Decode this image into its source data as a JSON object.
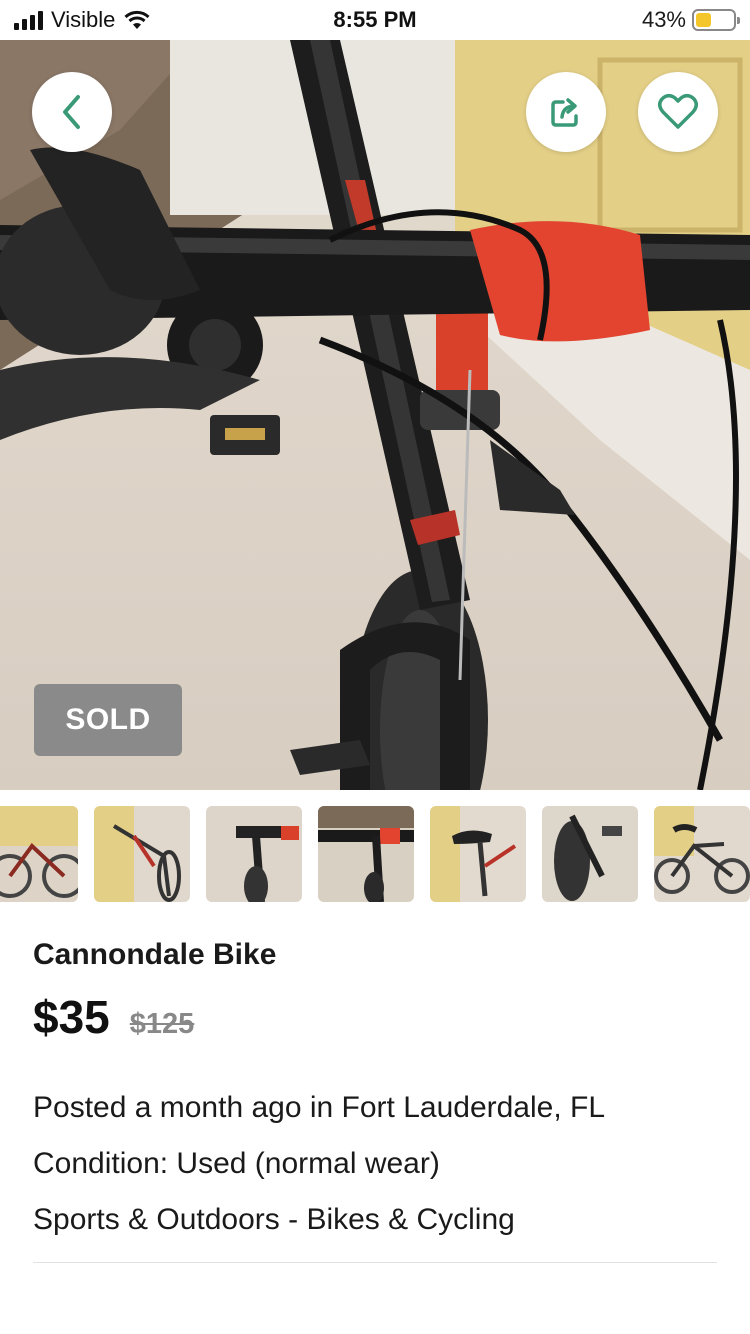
{
  "status_bar": {
    "carrier": "Visible",
    "time": "8:55 PM",
    "battery_percent": "43%",
    "battery_level": 0.43
  },
  "hero": {
    "sold_label": "SOLD",
    "back_icon": "chevron-left-icon",
    "share_icon": "share-icon",
    "favorite_icon": "heart-icon"
  },
  "thumbnails": {
    "count": 7,
    "selected_index": 3
  },
  "listing": {
    "title": "Cannondale Bike",
    "price": "$35",
    "original_price": "$125",
    "posted": "Posted a month ago in Fort Lauderdale, FL",
    "condition": "Condition: Used (normal wear)",
    "category": "Sports & Outdoors - Bikes & Cycling"
  },
  "colors": {
    "accent": "#3a9a78",
    "sold_badge": "#8a8a8a",
    "original_price": "#888888"
  }
}
